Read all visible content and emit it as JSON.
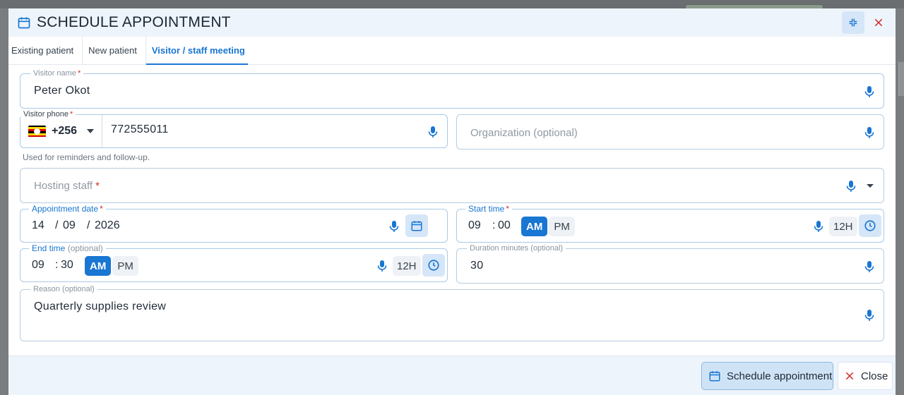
{
  "dialog": {
    "title": "SCHEDULE APPOINTMENT",
    "icons": {
      "title": "calendar-icon",
      "collapse": "collapse-icon",
      "close": "close-icon"
    }
  },
  "tabs": [
    {
      "label": "Existing patient",
      "active": false
    },
    {
      "label": "New patient",
      "active": false
    },
    {
      "label": "Visitor / staff meeting",
      "active": true
    }
  ],
  "form": {
    "visitor_name": {
      "label": "Visitor name",
      "required": "*",
      "value": "Peter Okot"
    },
    "visitor_phone": {
      "label": "Visitor phone",
      "required": "*",
      "country_code": "+256",
      "value": "772555011",
      "helper": "Used for reminders and follow-up."
    },
    "organization": {
      "placeholder_main": "Organization",
      "placeholder_opt": "(optional)"
    },
    "hosting_staff": {
      "placeholder": "Hosting staff",
      "required": "*"
    },
    "appointment_date": {
      "label": "Appointment date",
      "required": "*",
      "day": "14",
      "month": "09",
      "year": "2026",
      "sep": "/"
    },
    "start_time": {
      "label": "Start time",
      "required": "*",
      "hour": "09",
      "minute": "00",
      "sep": ":",
      "am": "AM",
      "pm": "PM",
      "format": "12H"
    },
    "end_time": {
      "label": "End time",
      "optional": "(optional)",
      "hour": "09",
      "minute": "30",
      "sep": ":",
      "am": "AM",
      "pm": "PM",
      "format": "12H"
    },
    "duration": {
      "label": "Duration minutes",
      "optional": "(optional)",
      "value": "30"
    },
    "reason": {
      "label": "Reason",
      "optional": "(optional)",
      "value": "Quarterly supplies review"
    }
  },
  "footer": {
    "schedule_label": "Schedule appointment",
    "close_label": "Close"
  },
  "colors": {
    "accent": "#1976d2",
    "danger": "#d32f2f",
    "header_bg": "#eef4fb",
    "flag": [
      "#000000",
      "#fcdc04",
      "#d90000",
      "#000000",
      "#fcdc04",
      "#d90000"
    ]
  }
}
